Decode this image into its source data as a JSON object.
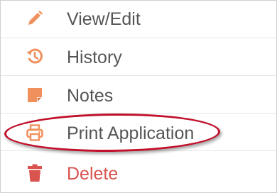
{
  "menu": {
    "items": [
      {
        "label": "View/Edit",
        "icon": "pencil-icon"
      },
      {
        "label": "History",
        "icon": "history-icon"
      },
      {
        "label": "Notes",
        "icon": "note-icon"
      },
      {
        "label": "Print Application",
        "icon": "printer-icon"
      },
      {
        "label": "Delete",
        "icon": "trash-icon"
      }
    ]
  },
  "colors": {
    "icon_orange": "#f0915d",
    "text_gray": "#555555",
    "delete_red": "#d9534f",
    "annotation_red": "#c0102a"
  }
}
